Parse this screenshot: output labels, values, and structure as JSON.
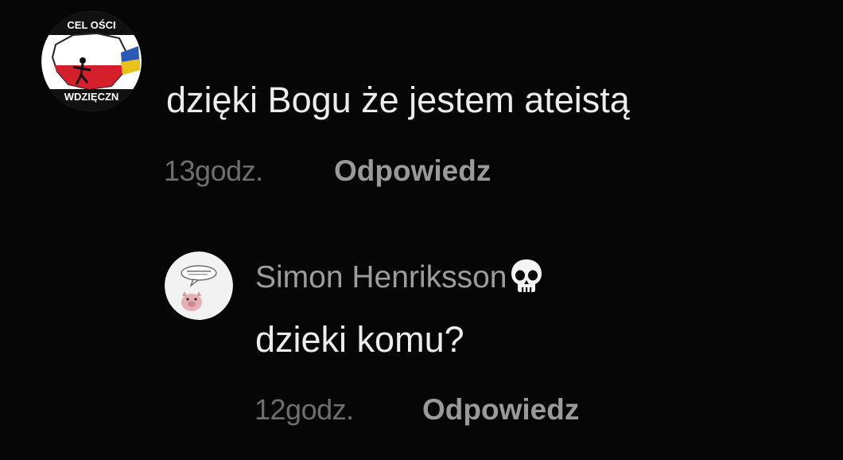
{
  "comments": {
    "main": {
      "text": "dzięki Bogu że jestem ateistą",
      "time": "13godz.",
      "reply_label": "Odpowiedz",
      "avatar_icon": "profile-avatar-poland-map"
    },
    "reply": {
      "author": "Simon Henriksson",
      "author_emoji": "skull-icon",
      "text": "dzieki komu?",
      "time": "12godz.",
      "reply_label": "Odpowiedz",
      "avatar_icon": "profile-avatar-pig-speech-bubble"
    }
  },
  "colors": {
    "background": "#060606",
    "comment_text": "#ececec",
    "timestamp": "#6e6e6e",
    "reply_link": "#9a9a9a",
    "author_name": "#9d9d9d"
  }
}
